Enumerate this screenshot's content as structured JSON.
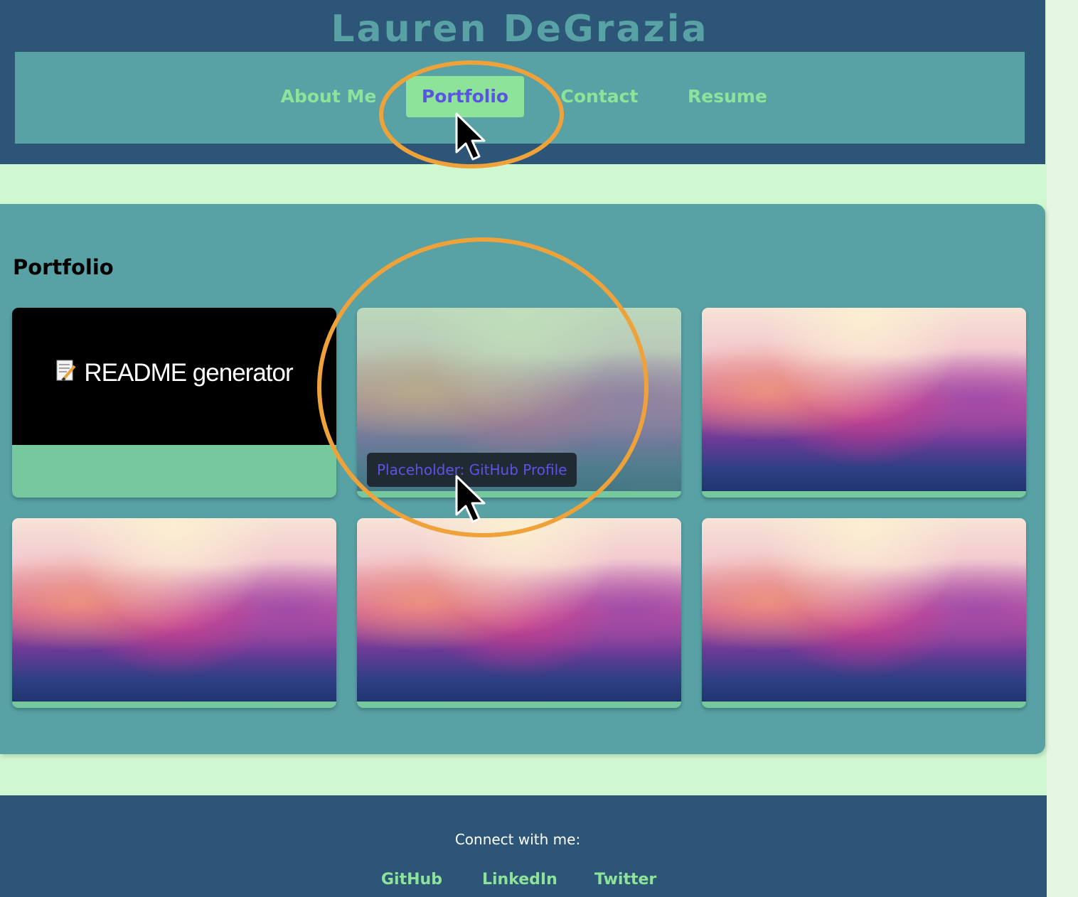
{
  "header": {
    "site_title": "Lauren DeGrazia"
  },
  "nav": {
    "items": [
      {
        "label": "About Me",
        "active": false
      },
      {
        "label": "Portfolio",
        "active": true
      },
      {
        "label": "Contact",
        "active": false
      },
      {
        "label": "Resume",
        "active": false
      }
    ]
  },
  "portfolio": {
    "title": "Portfolio",
    "cards": [
      {
        "label": "README generator",
        "icon": "memo-icon"
      },
      {
        "tooltip": "Placeholder: GitHub Profile",
        "state": "hovered"
      },
      {
        "image": "watercolor-cloud"
      },
      {
        "image": "watercolor-cloud"
      },
      {
        "image": "watercolor-cloud"
      },
      {
        "image": "watercolor-cloud"
      }
    ]
  },
  "footer": {
    "connect_text": "Connect with me:",
    "links": [
      "GitHub",
      "LinkedIn",
      "Twitter"
    ]
  },
  "colors": {
    "header_bg": "#2d5577",
    "nav_bg": "#58a2a6",
    "accent_green": "#8ee39a",
    "active_text": "#5b52e6",
    "page_bg": "#cff7d0",
    "annotation_orange": "#f0a23a"
  }
}
